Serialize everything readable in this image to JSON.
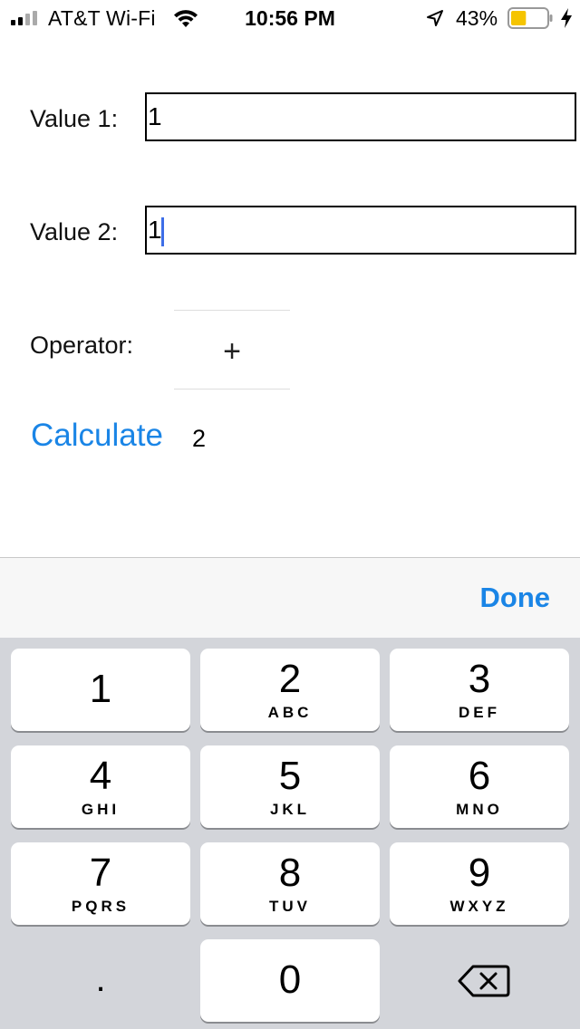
{
  "status_bar": {
    "carrier": "AT&T Wi-Fi",
    "time": "10:56 PM",
    "battery_percent": "43%",
    "battery_level": 0.43,
    "battery_color": "#f5c400",
    "icons": [
      "signal-icon",
      "wifi-icon",
      "location-arrow-icon",
      "battery-icon",
      "charging-bolt-icon"
    ]
  },
  "form": {
    "value1": {
      "label": "Value 1:",
      "value": "1"
    },
    "value2": {
      "label": "Value 2:",
      "value": "1"
    },
    "operator": {
      "label": "Operator:",
      "value": "+"
    },
    "calculate_label": "Calculate",
    "result": "2"
  },
  "keyboard": {
    "done_label": "Done",
    "accent_color": "#1a85e6",
    "keys": [
      {
        "digit": "1",
        "letters": ""
      },
      {
        "digit": "2",
        "letters": "ABC"
      },
      {
        "digit": "3",
        "letters": "DEF"
      },
      {
        "digit": "4",
        "letters": "GHI"
      },
      {
        "digit": "5",
        "letters": "JKL"
      },
      {
        "digit": "6",
        "letters": "MNO"
      },
      {
        "digit": "7",
        "letters": "PQRS"
      },
      {
        "digit": "8",
        "letters": "TUV"
      },
      {
        "digit": "9",
        "letters": "WXYZ"
      },
      {
        "digit": "0",
        "letters": ""
      }
    ],
    "decimal_key": ".",
    "delete_icon": "backspace-icon"
  }
}
